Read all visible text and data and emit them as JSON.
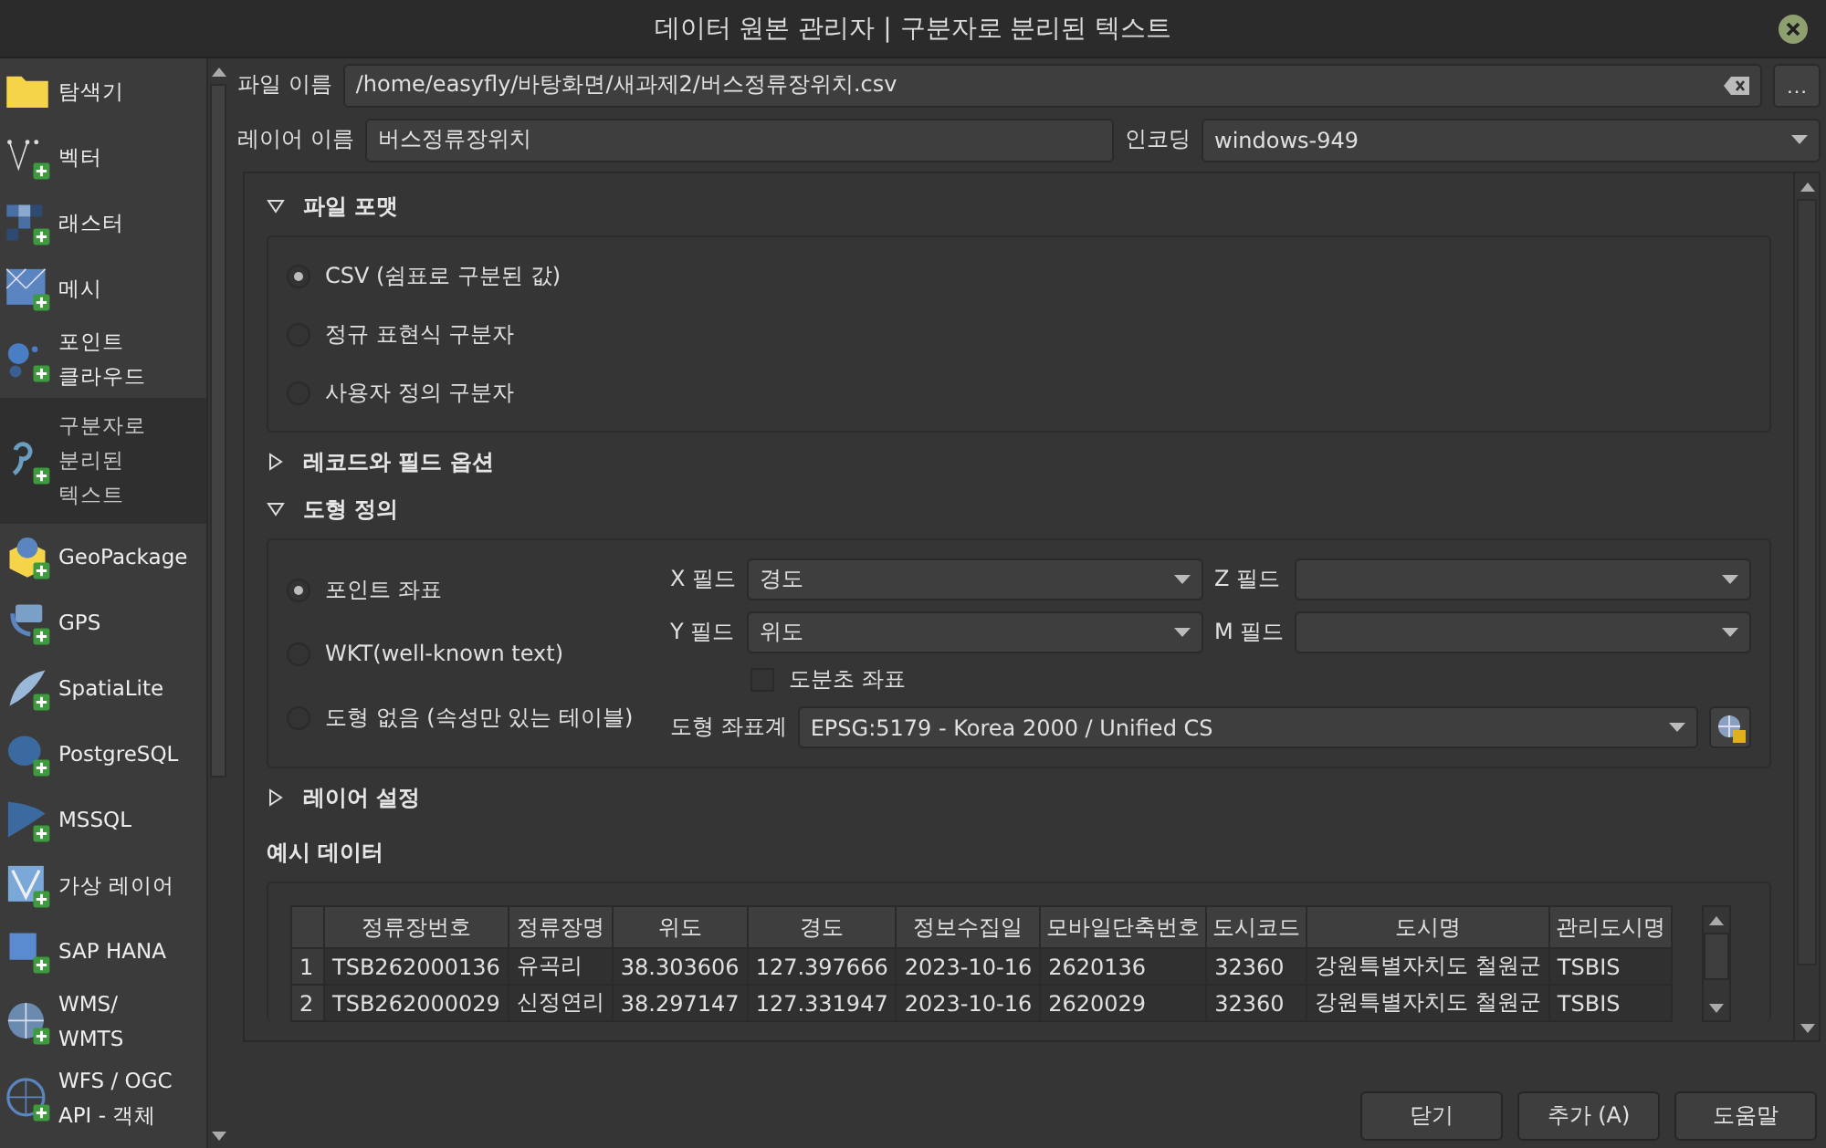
{
  "window": {
    "title": "데이터 원본 관리자 | 구분자로 분리된 텍스트"
  },
  "sidebar": {
    "items": [
      {
        "label": "탐색기",
        "selected": false
      },
      {
        "label": "벡터",
        "selected": false
      },
      {
        "label": "래스터",
        "selected": false
      },
      {
        "label": "메시",
        "selected": false
      },
      {
        "label": "포인트\n클라우드",
        "selected": false
      },
      {
        "label": "구분자로\n분리된\n텍스트",
        "selected": true
      },
      {
        "label": "GeoPackage",
        "selected": false
      },
      {
        "label": "GPS",
        "selected": false
      },
      {
        "label": "SpatiaLite",
        "selected": false
      },
      {
        "label": "PostgreSQL",
        "selected": false
      },
      {
        "label": "MSSQL",
        "selected": false
      },
      {
        "label": "가상 레이어",
        "selected": false
      },
      {
        "label": "SAP HANA",
        "selected": false
      },
      {
        "label": "WMS/\nWMTS",
        "selected": false
      },
      {
        "label": "WFS / OGC\nAPI - 객체",
        "selected": false
      }
    ]
  },
  "file_name": {
    "label": "파일 이름",
    "value": "/home/easyfly/바탕화면/새과제2/버스정류장위치.csv",
    "browse": "…"
  },
  "layer_name": {
    "label": "레이어 이름",
    "value": "버스정류장위치"
  },
  "encoding": {
    "label": "인코딩",
    "value": "windows-949"
  },
  "file_format": {
    "title": "파일 포맷",
    "expanded": true,
    "options": [
      {
        "label": "CSV (쉼표로 구분된 값)",
        "selected": true
      },
      {
        "label": "정규 표현식 구분자",
        "selected": false
      },
      {
        "label": "사용자 정의 구분자",
        "selected": false
      }
    ]
  },
  "record_options": {
    "title": "레코드와 필드 옵션",
    "expanded": false
  },
  "geometry": {
    "title": "도형 정의",
    "expanded": true,
    "options": [
      {
        "label": "포인트 좌표",
        "selected": true
      },
      {
        "label": "WKT(well-known text)",
        "selected": false
      },
      {
        "label": "도형 없음 (속성만 있는 테이블)",
        "selected": false
      }
    ],
    "x_field": {
      "label": "X 필드",
      "value": "경도"
    },
    "y_field": {
      "label": "Y 필드",
      "value": "위도"
    },
    "z_field": {
      "label": "Z 필드"
    },
    "m_field": {
      "label": "M 필드"
    },
    "dms": {
      "label": "도분초 좌표",
      "checked": false
    },
    "crs": {
      "label": "도형 좌표계",
      "value": "EPSG:5179 - Korea 2000 / Unified CS"
    }
  },
  "layer_settings": {
    "title": "레이어 설정",
    "expanded": false
  },
  "sample_data": {
    "title": "예시 데이터",
    "columns": [
      "정류장번호",
      "정류장명",
      "위도",
      "경도",
      "정보수집일",
      "모바일단축번호",
      "도시코드",
      "도시명",
      "관리도시명"
    ],
    "rows": [
      {
        "index": "1",
        "cells": [
          "TSB262000136",
          "유곡리",
          "38.303606",
          "127.397666",
          "2023-10-16",
          "2620136",
          "32360",
          "강원특별자치도 철원군",
          "TSBIS"
        ]
      },
      {
        "index": "2",
        "cells": [
          "TSB262000029",
          "신정연리",
          "38.297147",
          "127.331947",
          "2023-10-16",
          "2620029",
          "32360",
          "강원특별자치도 철원군",
          "TSBIS"
        ]
      }
    ]
  },
  "buttons": [
    "닫기",
    "추가 (A)",
    "도움말"
  ]
}
